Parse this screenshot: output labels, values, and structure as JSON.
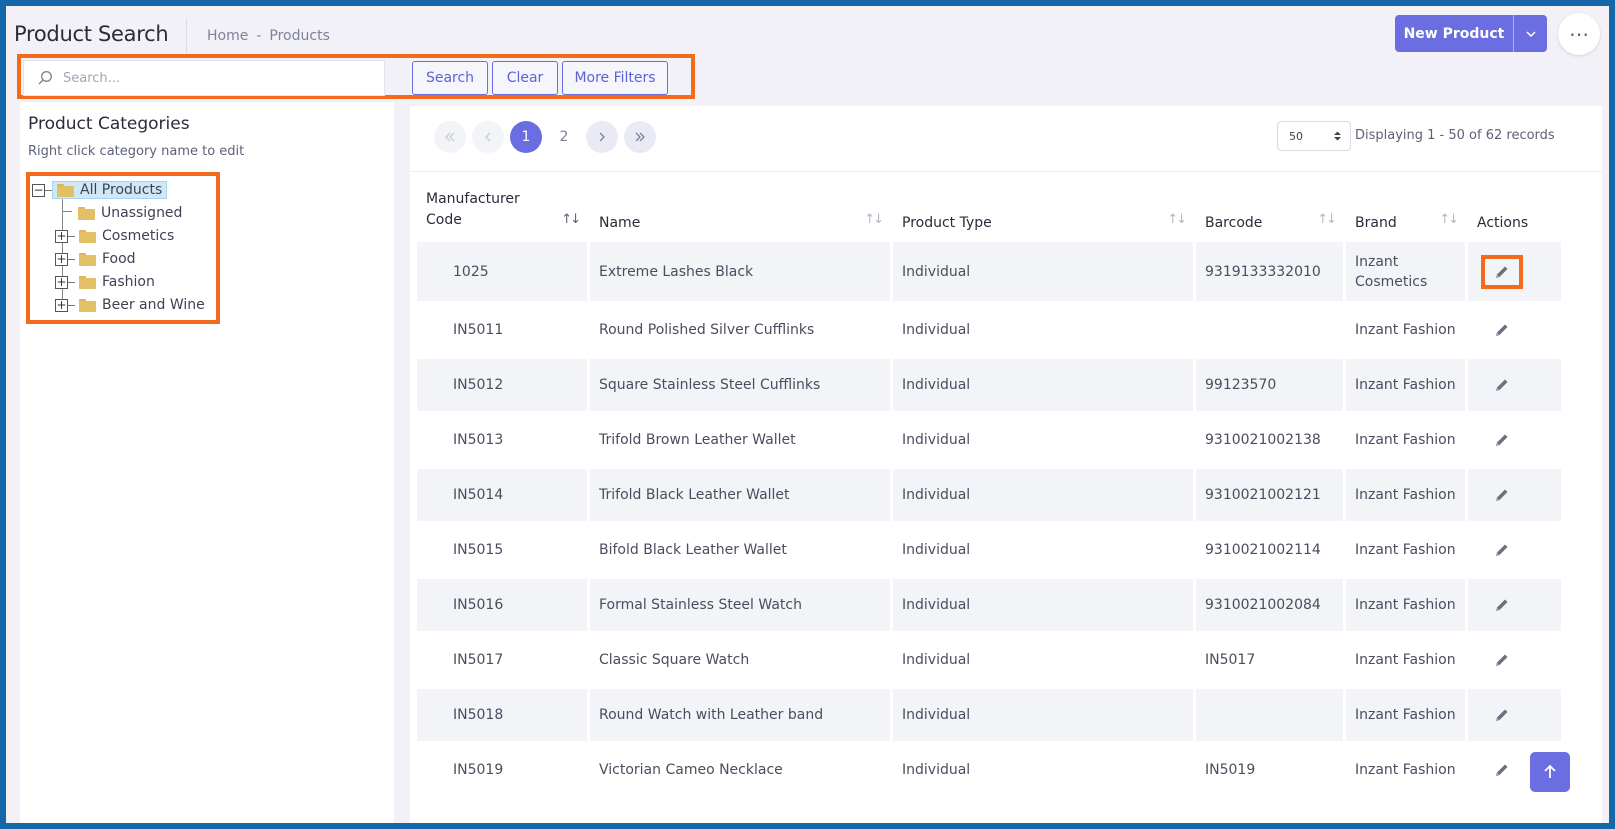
{
  "header": {
    "title": "Product Search",
    "breadcrumb": [
      "Home",
      "-",
      "Products"
    ],
    "new_product_label": "New Product"
  },
  "search": {
    "placeholder": "Search...",
    "value": "",
    "search_label": "Search",
    "clear_label": "Clear",
    "more_filters_label": "More Filters"
  },
  "categories": {
    "title": "Product Categories",
    "subtitle": "Right click category name to edit",
    "items": [
      {
        "label": "All Products",
        "toggle": "−"
      },
      {
        "label": "Unassigned",
        "toggle": ""
      },
      {
        "label": "Cosmetics",
        "toggle": "+"
      },
      {
        "label": "Food",
        "toggle": "+"
      },
      {
        "label": "Fashion",
        "toggle": "+"
      },
      {
        "label": "Beer and Wine",
        "toggle": "+"
      }
    ]
  },
  "pager": {
    "pages": [
      "1",
      "2"
    ],
    "page_size": "50",
    "displaying": "Displaying 1 - 50 of 62 records"
  },
  "table": {
    "columns": [
      "Manufacturer Code",
      "Name",
      "Product Type",
      "Barcode",
      "Brand",
      "Actions"
    ],
    "rows": [
      {
        "code": "1025",
        "name": "Extreme Lashes Black",
        "type": "Individual",
        "barcode": "9319133332010",
        "brand": "Inzant Cosmetics"
      },
      {
        "code": "IN5011",
        "name": "Round Polished Silver Cufflinks",
        "type": "Individual",
        "barcode": "",
        "brand": "Inzant Fashion"
      },
      {
        "code": "IN5012",
        "name": "Square Stainless Steel Cufflinks",
        "type": "Individual",
        "barcode": "99123570",
        "brand": "Inzant Fashion"
      },
      {
        "code": "IN5013",
        "name": "Trifold Brown Leather Wallet",
        "type": "Individual",
        "barcode": "9310021002138",
        "brand": "Inzant Fashion"
      },
      {
        "code": "IN5014",
        "name": "Trifold Black Leather Wallet",
        "type": "Individual",
        "barcode": "9310021002121",
        "brand": "Inzant Fashion"
      },
      {
        "code": "IN5015",
        "name": "Bifold Black Leather Wallet",
        "type": "Individual",
        "barcode": "9310021002114",
        "brand": "Inzant Fashion"
      },
      {
        "code": "IN5016",
        "name": "Formal Stainless Steel Watch",
        "type": "Individual",
        "barcode": "9310021002084",
        "brand": "Inzant Fashion"
      },
      {
        "code": "IN5017",
        "name": "Classic Square Watch",
        "type": "Individual",
        "barcode": "IN5017",
        "brand": "Inzant Fashion"
      },
      {
        "code": "IN5018",
        "name": "Round Watch with Leather band",
        "type": "Individual",
        "barcode": "",
        "brand": "Inzant Fashion"
      },
      {
        "code": "IN5019",
        "name": "Victorian Cameo Necklace",
        "type": "Individual",
        "barcode": "IN5019",
        "brand": "Inzant Fashion"
      }
    ]
  },
  "colors": {
    "accent": "#6a6ee0",
    "highlight": "#f26b1d",
    "frame": "#1467a8"
  }
}
